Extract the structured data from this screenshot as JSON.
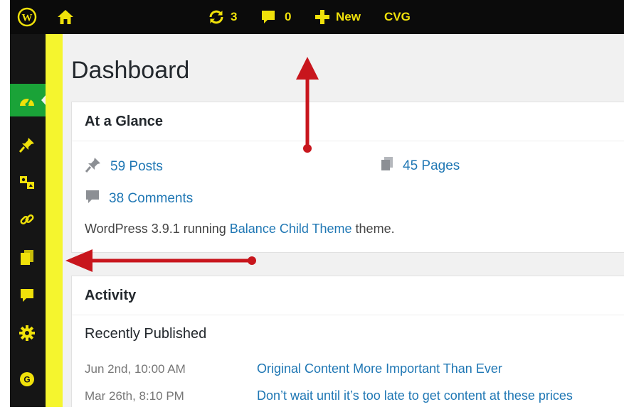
{
  "admin_bar": {
    "updates_count": "3",
    "comments_count": "0",
    "new_label": "New",
    "site_label": "CVG",
    "icons": [
      "wordpress-logo",
      "home-icon",
      "refresh-icon",
      "comment-icon",
      "plus-icon"
    ]
  },
  "sidebar": {
    "items": [
      "dashboard-icon",
      "pin-icon",
      "media-icon",
      "link-icon",
      "pages-icon",
      "comments-icon",
      "settings-icon",
      "g-icon",
      "tools-icon"
    ],
    "active_color": "#1aa338"
  },
  "page": {
    "title": "Dashboard"
  },
  "at_a_glance": {
    "title": "At a Glance",
    "posts": "59 Posts",
    "pages": "45 Pages",
    "comments": "38 Comments",
    "version_prefix": "WordPress 3.9.1 running ",
    "theme_link": "Balance Child Theme",
    "version_suffix": " theme."
  },
  "activity": {
    "title": "Activity",
    "recent_heading": "Recently Published",
    "items": [
      {
        "date": "Jun 2nd, 10:00 AM",
        "title": "Original Content More Important Than Ever"
      },
      {
        "date": "Mar 26th, 8:10 PM",
        "title": "Don’t wait until it’s too late to get content at these prices"
      }
    ]
  },
  "colors": {
    "admin_bar_bg": "#0b0b0b",
    "admin_bar_text": "#f0e10a",
    "highlight_bar": "#f5f52e",
    "annotation_arrow": "#c8161d",
    "link": "#1f77b4"
  }
}
